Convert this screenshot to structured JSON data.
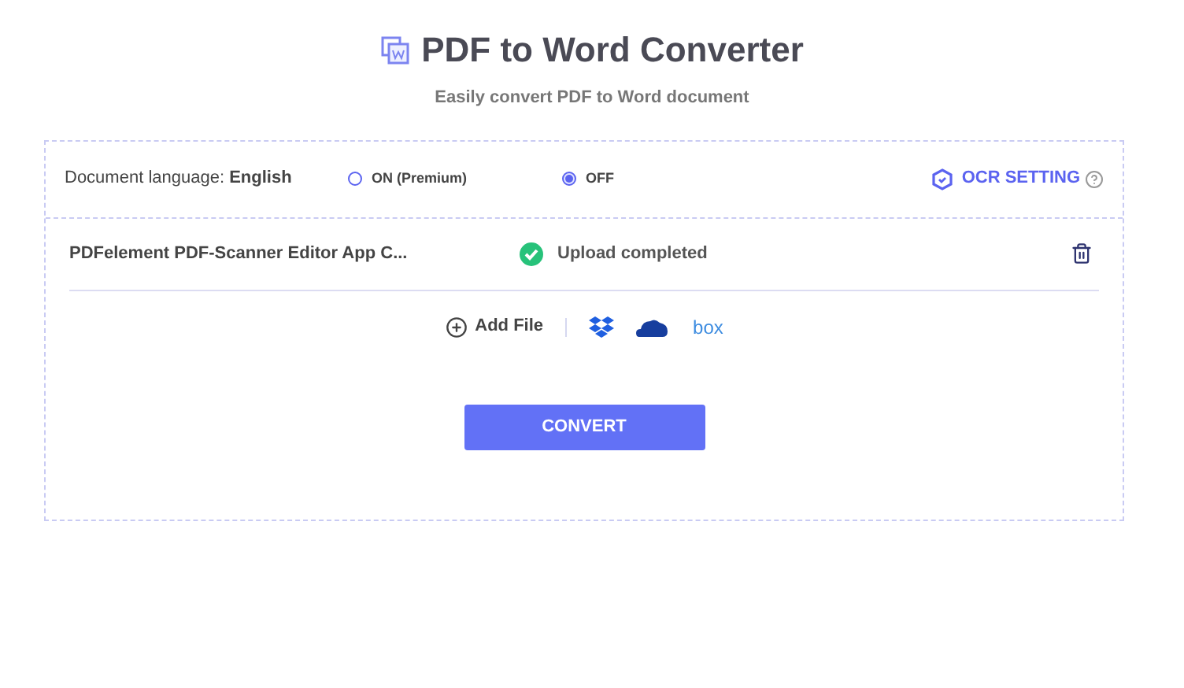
{
  "header": {
    "title": "PDF to Word Converter",
    "subtitle": "Easily convert PDF to Word document"
  },
  "settings": {
    "language_label": "Document language:",
    "language": "English",
    "ocr_options": [
      {
        "label": "ON (Premium)",
        "selected": false
      },
      {
        "label": "OFF",
        "selected": true
      }
    ],
    "ocr_setting": "OCR SETTING"
  },
  "files": [
    {
      "name": "PDFelement PDF-Scanner Editor App C...",
      "status": "Upload completed"
    }
  ],
  "add_file": {
    "label": "Add File",
    "box_logo": "box"
  },
  "convert_button": "CONVERT"
}
